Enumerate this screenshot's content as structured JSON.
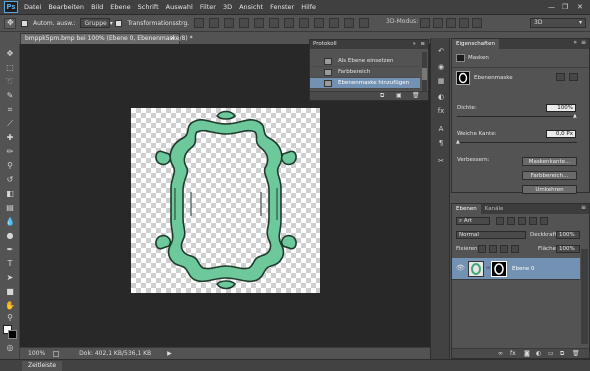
{
  "app": {
    "logo": "Ps"
  },
  "menu": [
    "Datei",
    "Bearbeiten",
    "Bild",
    "Ebene",
    "Schrift",
    "Auswahl",
    "Filter",
    "3D",
    "Ansicht",
    "Fenster",
    "Hilfe"
  ],
  "options": {
    "auto_select": "Autom. ausw.:",
    "auto_select_value": "Gruppe",
    "transform_controls": "Transformationsstrg.",
    "mode_3d": "3D-Modus:",
    "workspace": "3D"
  },
  "document": {
    "tab_title": "bmppk5pm.bmp bei 100% (Ebene 0, Ebenenmaske/8) *",
    "zoom": "100%",
    "doc_info": "Dok: 402,1 KB/536,1 KB"
  },
  "timeline": {
    "tab": "Zeitleiste"
  },
  "history": {
    "title": "Protokoll",
    "items": [
      {
        "label": "Als Ebene einsetzen",
        "selected": false
      },
      {
        "label": "Farbbereich",
        "selected": false
      },
      {
        "label": "Ebenenmaske hinzufügen",
        "selected": true
      }
    ]
  },
  "properties": {
    "tab": "Eigenschaften",
    "section": "Masken",
    "mask_type": "Ebenenmaske",
    "density_label": "Dichte:",
    "density_value": "100%",
    "feather_label": "Weiche Kante:",
    "feather_value": "0,0 Px",
    "refine_label": "Verbessern:",
    "mask_edge_button": "Maskenkante...",
    "color_range_button": "Farbbereich...",
    "invert_button": "Umkehren"
  },
  "layers": {
    "tabs": [
      "Ebenen",
      "Kanäle"
    ],
    "filter_kind": "Art",
    "blend_mode": "Normal",
    "opacity_label": "Deckkraft:",
    "opacity_value": "100%",
    "lock_label": "Fixieren:",
    "fill_label": "Fläche:",
    "fill_value": "100%",
    "items": [
      {
        "name": "Ebene 0",
        "visible": true,
        "selected": true
      }
    ]
  },
  "colors": {
    "frame_fill": "#6dc99b",
    "frame_stroke": "#1f3b2c",
    "selection": "#7391b3"
  }
}
